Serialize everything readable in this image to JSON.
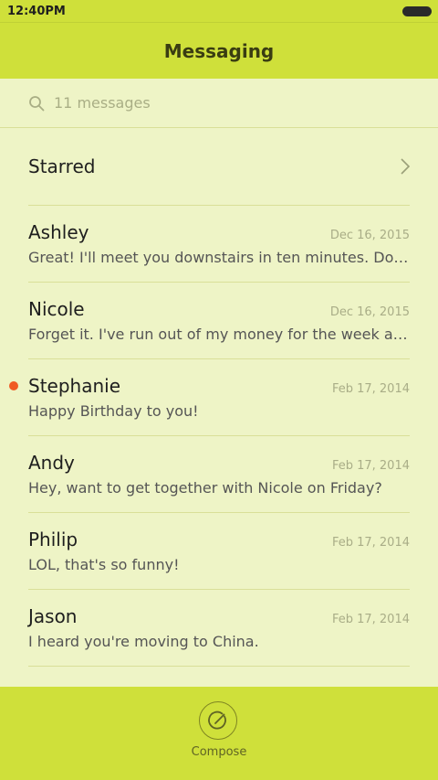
{
  "status": {
    "time": "12:40PM"
  },
  "header": {
    "title": "Messaging"
  },
  "search": {
    "placeholder": "11 messages"
  },
  "starred": {
    "label": "Starred"
  },
  "messages": [
    {
      "name": "Ashley",
      "date": "Dec 16, 2015",
      "preview": "Great! I'll meet you downstairs in ten minutes. Don't forget to bring the tickets.",
      "unread": false
    },
    {
      "name": "Nicole",
      "date": "Dec 16, 2015",
      "preview": "Forget it. I've run out of my money for the week already.",
      "unread": false
    },
    {
      "name": "Stephanie",
      "date": "Feb 17, 2014",
      "preview": "Happy Birthday to you!",
      "unread": true
    },
    {
      "name": "Andy",
      "date": "Feb 17, 2014",
      "preview": "Hey, want to get together with Nicole on Friday?",
      "unread": false
    },
    {
      "name": "Philip",
      "date": "Feb 17, 2014",
      "preview": "LOL, that's so funny!",
      "unread": false
    },
    {
      "name": "Jason",
      "date": "Feb 17, 2014",
      "preview": "I heard you're moving to China.",
      "unread": false
    }
  ],
  "compose": {
    "label": "Compose"
  },
  "colors": {
    "accent": "#cfe03a",
    "background": "#eef4c6",
    "unread": "#f05a24"
  }
}
